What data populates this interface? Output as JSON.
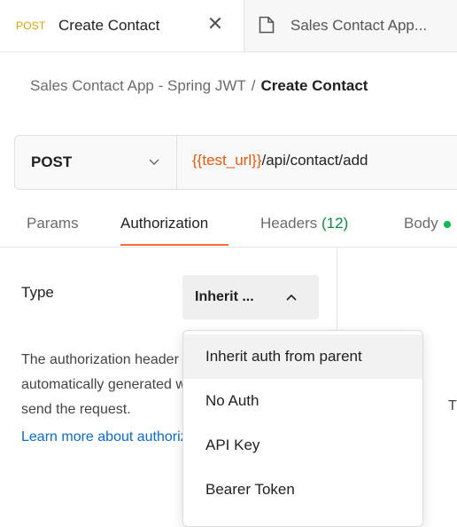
{
  "tabs": {
    "active": {
      "method": "POST",
      "title": "Create Contact",
      "close_glyph": "✕"
    },
    "inactive": {
      "title": "Sales Contact App..."
    }
  },
  "breadcrumb": {
    "parent": "Sales Contact App - Spring JWT",
    "separator": "/",
    "current": "Create Contact"
  },
  "request": {
    "method": "POST",
    "url_variable": "{{test_url}}",
    "url_path": "/api/contact/add"
  },
  "request_tabs": [
    {
      "label": "Params"
    },
    {
      "label": "Authorization"
    },
    {
      "label": "Headers",
      "count": "(12)"
    },
    {
      "label": "Body"
    }
  ],
  "auth": {
    "type_label": "Type",
    "selected": "Inherit ...",
    "description_lines": [
      "The authorization header will be",
      "automatically generated when you",
      "send the request."
    ],
    "learn_more": "Learn more about authorization",
    "right_fragment": "T"
  },
  "dropdown": {
    "options": [
      "Inherit auth from parent",
      "No Auth",
      "API Key",
      "Bearer Token"
    ],
    "highlighted_index": 0
  },
  "colors": {
    "accent": "#ff6c37",
    "method_post": "#e0a100",
    "variable": "#e8590c",
    "link": "#0b6bcb",
    "success": "#0cbb52"
  }
}
